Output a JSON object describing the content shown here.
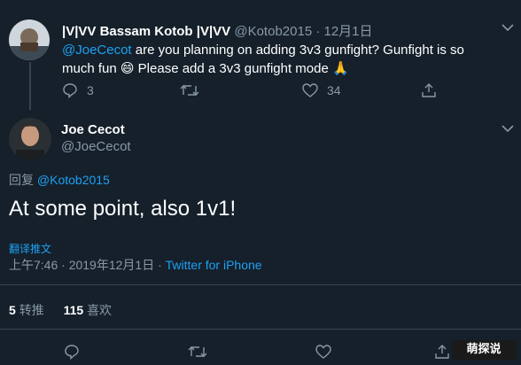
{
  "parent_tweet": {
    "display_name": "|V|VV Bassam Kotob |V|VV",
    "handle": "@Kotob2015",
    "separator": "·",
    "date": "12月1日",
    "mention": "@JoeCecot",
    "text_1": " are you planning on adding 3v3 gunfight? Gunfight is so",
    "text_2": "much fun 😄 Please add a 3v3 gunfight mode 🙏",
    "replies": "3",
    "likes": "34"
  },
  "main_tweet": {
    "display_name": "Joe Cecot",
    "handle": "@JoeCecot",
    "reply_prefix": "回复 ",
    "reply_to": "@Kotob2015",
    "text": "At some point, also 1v1!",
    "translate_label": "翻译推文",
    "timestamp": "上午7:46 · 2019年12月1日 · ",
    "source": "Twitter for iPhone",
    "retweets_count": "5",
    "retweets_label": "转推",
    "likes_count": "115",
    "likes_label": "喜欢"
  },
  "watermark": "萌探说",
  "colors": {
    "background": "#15202b",
    "accent": "#1da1f2",
    "muted": "#8899a6",
    "divider": "#38444d"
  }
}
